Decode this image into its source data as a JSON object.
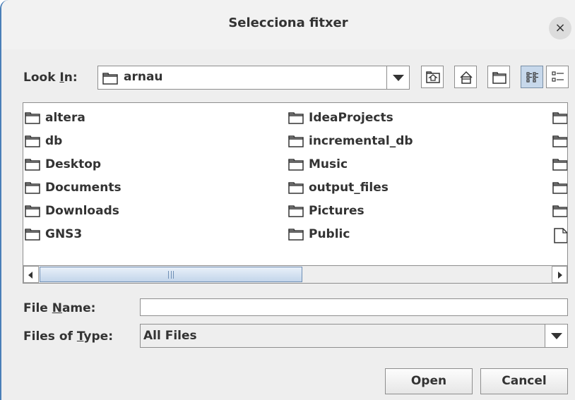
{
  "dialog": {
    "title": "Selecciona fitxer",
    "close_label": "×"
  },
  "lookin": {
    "label_pre": "Look ",
    "label_mnemonic": "I",
    "label_post": "n:",
    "value": "arnau"
  },
  "toolbar": {
    "buttons": [
      {
        "name": "up-one-level-button",
        "icon": "up-folder-icon"
      },
      {
        "name": "home-button",
        "icon": "home-icon"
      },
      {
        "name": "new-folder-button",
        "icon": "new-folder-icon"
      },
      {
        "name": "list-view-button",
        "icon": "list-view-icon",
        "pressed": true
      },
      {
        "name": "details-view-button",
        "icon": "details-view-icon"
      }
    ]
  },
  "files": {
    "column1": [
      "altera",
      "db",
      "Desktop",
      "Documents",
      "Downloads",
      "GNS3"
    ],
    "column2": [
      "IdeaProjects",
      "incremental_db",
      "Music",
      "output_files",
      "Pictures",
      "Public"
    ]
  },
  "filename": {
    "label_pre": "File ",
    "label_mnemonic": "N",
    "label_post": "ame:",
    "value": ""
  },
  "filetype": {
    "label_pre": "Files of ",
    "label_mnemonic": "T",
    "label_post": "ype:",
    "value": "All Files"
  },
  "buttons": {
    "open": "Open",
    "cancel": "Cancel"
  },
  "colors": {
    "background": "#eeeeee",
    "selection": "#c7d8eb",
    "border": "#8e8e8e",
    "text": "#333333"
  }
}
